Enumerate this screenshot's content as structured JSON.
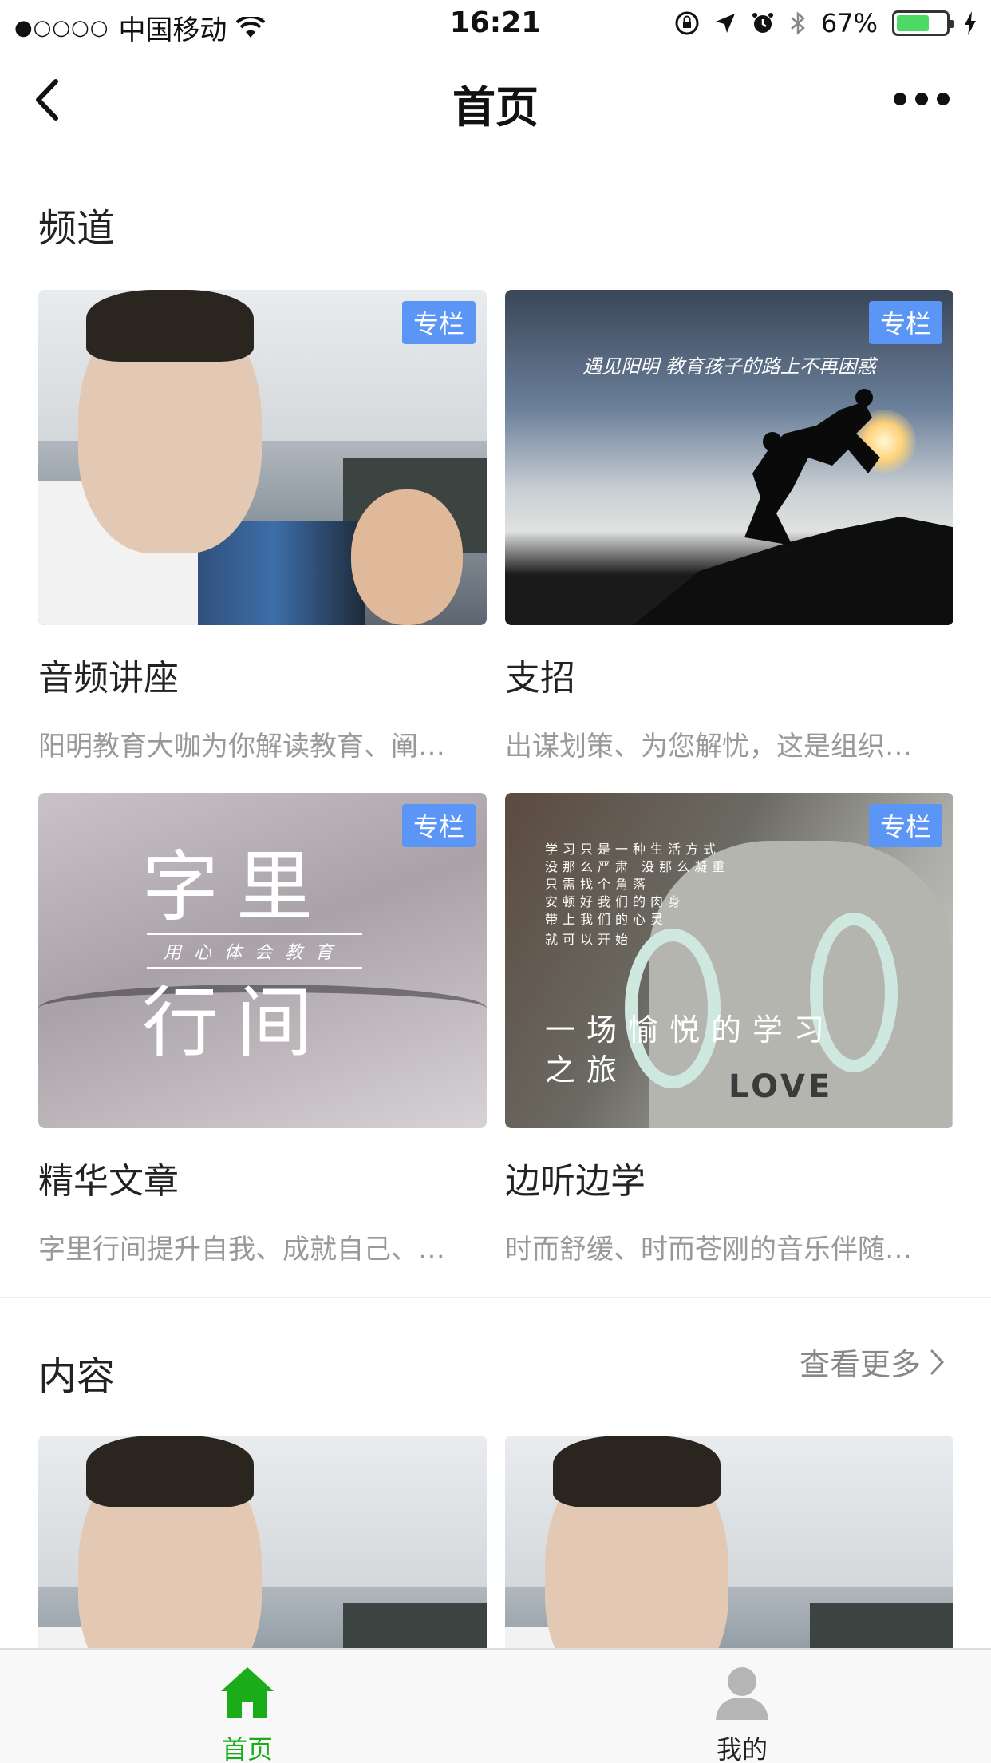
{
  "status_bar": {
    "signal": "●○○○○",
    "carrier": "中国移动",
    "time": "16:21",
    "battery_percent": "67%",
    "battery_level": 0.67,
    "accent_battery": "#4cd964"
  },
  "nav": {
    "title": "首页",
    "back_icon": "chevron-left-icon",
    "more_icon": "more-dots-icon"
  },
  "channels": {
    "title": "频道",
    "badge_color": "#5b96f6",
    "items": [
      {
        "badge": "专栏",
        "title": "音频讲座",
        "desc": "阳明教育大咖为你解读教育、阐…"
      },
      {
        "badge": "专栏",
        "title": "支招",
        "desc": "出谋划策、为您解忧，这是组织…",
        "image_caption": "遇见阳明   教育孩子的路上不再困惑"
      },
      {
        "badge": "专栏",
        "title": "精华文章",
        "desc": "字里行间提升自我、成就自己、…",
        "image_text_top": "字里",
        "image_text_sub": "用心体会教育",
        "image_text_bottom": "行间"
      },
      {
        "badge": "专栏",
        "title": "边听边学",
        "desc": "时而舒缓、时而苍刚的音乐伴随…",
        "image_lines": "学习只是一种生活方式\n没那么严肃 没那么凝重\n只需找个角落\n安顿好我们的肉身\n带上我们的心灵",
        "image_tag": "就可以开始",
        "image_tagline": "一场愉悦的学习\n之旅",
        "image_shirt": "LOVE"
      }
    ]
  },
  "content": {
    "title": "内容",
    "see_more": "查看更多"
  },
  "tabbar": {
    "active_color": "#1aad19",
    "inactive_color": "#222222",
    "tabs": [
      {
        "label": "首页",
        "icon": "home-icon",
        "active": true
      },
      {
        "label": "我的",
        "icon": "user-icon",
        "active": false
      }
    ]
  }
}
